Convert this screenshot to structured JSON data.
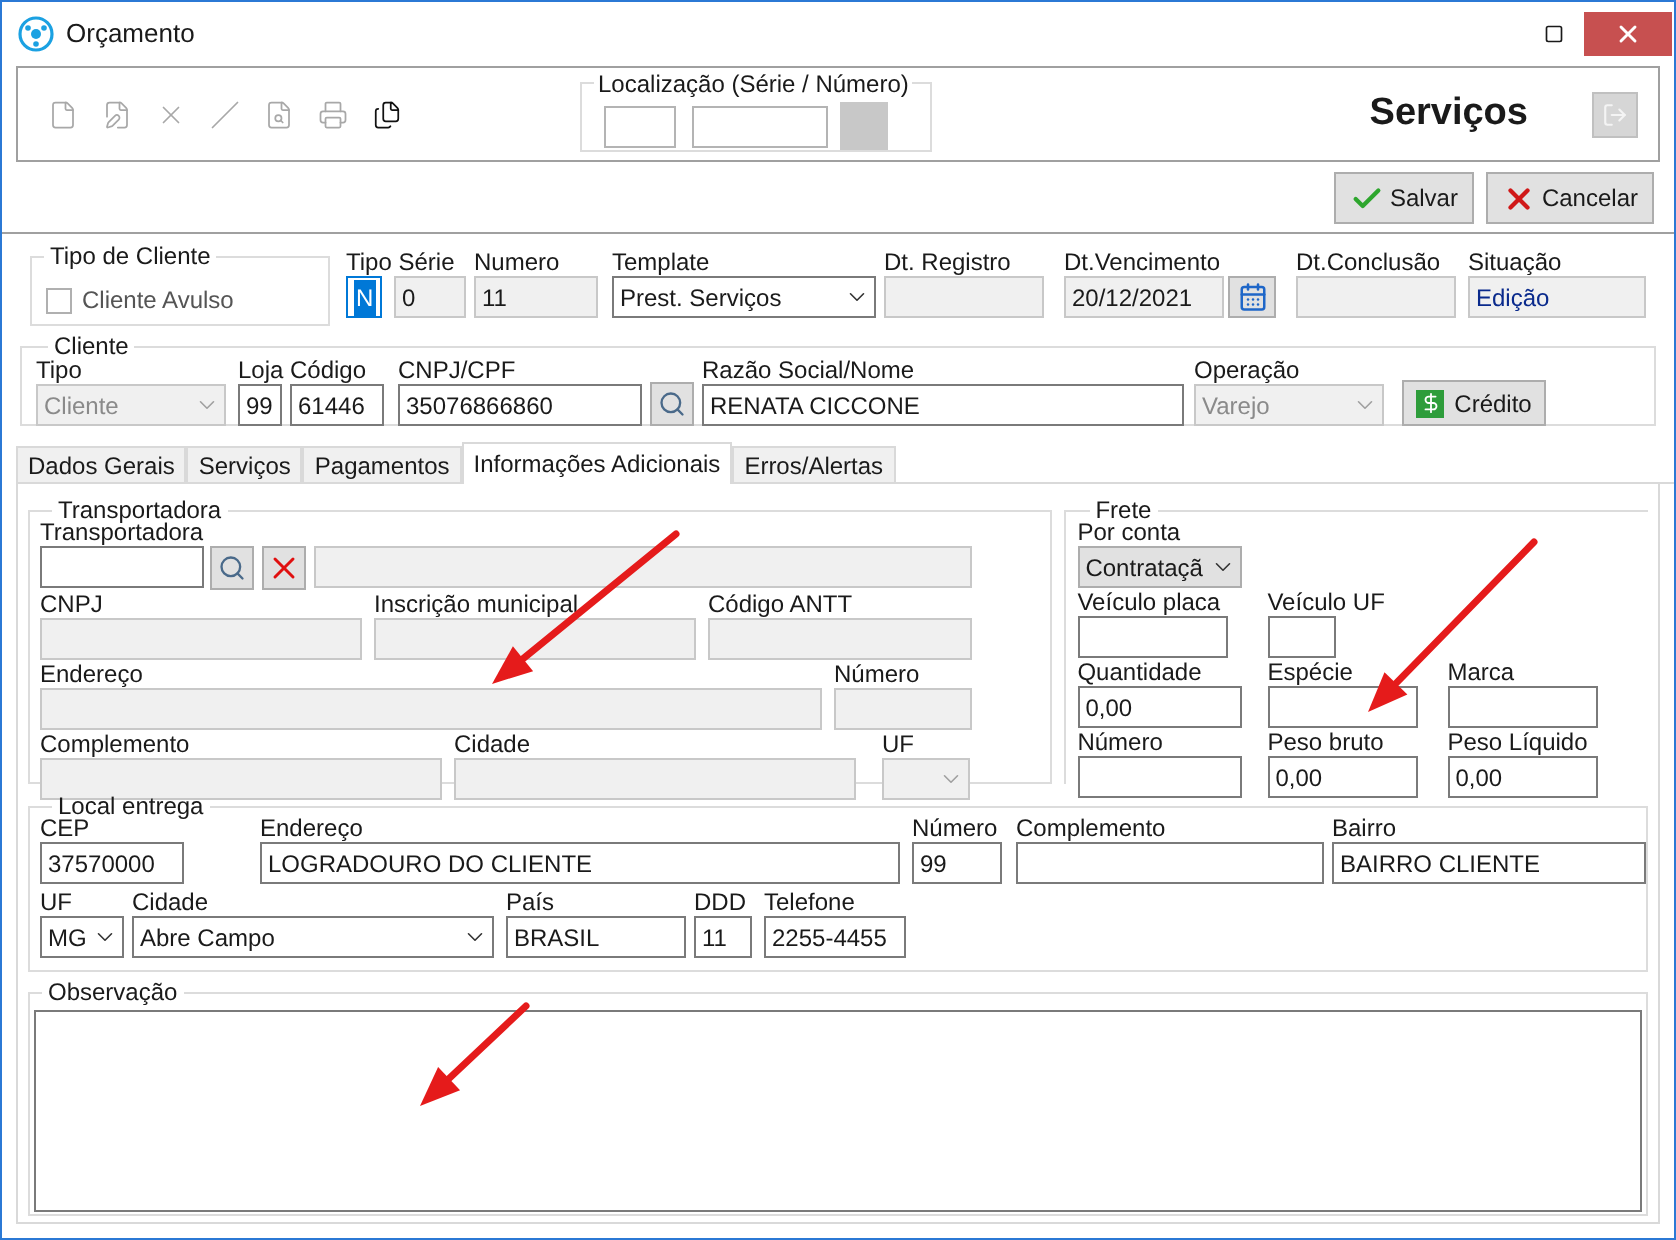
{
  "window": {
    "title": "Orçamento"
  },
  "toolbar": {
    "tools": [
      {
        "kind": "new",
        "disabled": true
      },
      {
        "kind": "edit",
        "disabled": true
      },
      {
        "kind": "delete",
        "disabled": true
      },
      {
        "kind": "pencil",
        "disabled": true
      },
      {
        "kind": "preview",
        "disabled": true
      },
      {
        "kind": "print",
        "disabled": true
      },
      {
        "kind": "copy",
        "disabled": false
      }
    ],
    "localizacao": {
      "label": "Localização (Série / Número)"
    },
    "module_title": "Serviços",
    "exit_button": {
      "disabled": true
    }
  },
  "actions": [
    {
      "kind": "save",
      "label": "Salvar"
    },
    {
      "kind": "cancel",
      "label": "Cancelar"
    }
  ],
  "tipo_cliente": {
    "title": "Tipo de Cliente",
    "checkbox": {
      "label": "Cliente Avulso",
      "checked": false
    }
  },
  "header_fields": [
    {
      "kind": "text",
      "label": "Tipo Série",
      "value": "N",
      "readonly": false,
      "focused": true
    },
    {
      "kind": "text",
      "value": "0",
      "readonly": true,
      "focused": false
    },
    {
      "kind": "text",
      "label": "Numero",
      "value": "11",
      "readonly": true,
      "focused": false
    },
    {
      "kind": "select",
      "label": "Template",
      "value": "Prest. Serviços",
      "disabled": false
    },
    {
      "kind": "text",
      "label": "Dt. Registro",
      "readonly": true,
      "focused": false
    },
    {
      "kind": "text",
      "label": "Dt.Vencimento",
      "value": "20/12/2021",
      "readonly": true,
      "focused": false
    },
    {
      "kind": "calendar_button"
    },
    {
      "kind": "text",
      "label": "Dt.Conclusão",
      "readonly": true,
      "focused": false
    },
    {
      "kind": "status",
      "label": "Situação",
      "value": "Edição"
    }
  ],
  "cliente": {
    "title": "Cliente",
    "fields": [
      {
        "kind": "select",
        "label": "Tipo",
        "value": "Cliente",
        "disabled": true
      },
      {
        "kind": "text",
        "label": "Loja",
        "value": "99",
        "readonly": false,
        "focused": false
      },
      {
        "kind": "text",
        "label": "Código",
        "value": "61446",
        "readonly": false,
        "focused": false
      },
      {
        "kind": "text",
        "label": "CNPJ/CPF",
        "value": "35076866860",
        "readonly": false,
        "focused": false
      },
      {
        "kind": "search_button"
      },
      {
        "kind": "text",
        "label": "Razão Social/Nome",
        "value": "RENATA CICCONE",
        "readonly": false,
        "focused": false
      },
      {
        "kind": "select",
        "label": "Operação",
        "value": "Varejo",
        "disabled": true
      },
      {
        "kind": "credit_button",
        "label": "Crédito"
      }
    ]
  },
  "tabs": [
    {
      "label": "Dados Gerais",
      "selected": false
    },
    {
      "label": "Serviços",
      "selected": false
    },
    {
      "label": "Pagamentos",
      "selected": false
    },
    {
      "label": "Informações Adicionais",
      "selected": true
    },
    {
      "label": "Erros/Alertas",
      "selected": false
    }
  ],
  "transportadora": {
    "title": "Transportadora",
    "rows": [
      {
        "fields": [
          {
            "kind": "text",
            "label": "Transportadora",
            "readonly": false,
            "focused": false
          },
          {
            "kind": "search_button"
          },
          {
            "kind": "clear_button"
          },
          {
            "kind": "text",
            "readonly": true,
            "focused": false
          }
        ]
      },
      {
        "fields": [
          {
            "kind": "text",
            "label": "CNPJ",
            "readonly": true,
            "focused": false
          },
          {
            "kind": "text",
            "label": "Inscrição municipal",
            "readonly": true,
            "focused": false
          },
          {
            "kind": "text",
            "label": "Código ANTT",
            "readonly": true,
            "focused": false
          }
        ]
      },
      {
        "fields": [
          {
            "kind": "text",
            "label": "Endereço",
            "readonly": true,
            "focused": false
          },
          {
            "kind": "text",
            "label": "Número",
            "readonly": true,
            "focused": false
          }
        ]
      },
      {
        "fields": [
          {
            "kind": "text",
            "label": "Complemento",
            "readonly": true,
            "focused": false
          },
          {
            "kind": "text",
            "label": "Cidade",
            "readonly": true,
            "focused": false
          },
          {
            "kind": "select",
            "label": "UF",
            "disabled": true
          }
        ]
      }
    ]
  },
  "frete": {
    "title": "Frete",
    "rows": [
      {
        "fields": [
          {
            "kind": "select",
            "label": "Por conta",
            "value": "Contrataçã",
            "disabled": false,
            "shaded": true
          }
        ]
      },
      {
        "fields": [
          {
            "kind": "text",
            "label": "Veículo placa",
            "readonly": false,
            "focused": false
          },
          {
            "kind": "text",
            "label": "Veículo UF",
            "readonly": false,
            "focused": false
          }
        ]
      },
      {
        "fields": [
          {
            "kind": "text",
            "label": "Quantidade",
            "value": "0,00",
            "readonly": false,
            "focused": false
          },
          {
            "kind": "text",
            "label": "Espécie",
            "readonly": false,
            "focused": false
          },
          {
            "kind": "text",
            "label": "Marca",
            "readonly": false,
            "focused": false
          }
        ]
      },
      {
        "fields": [
          {
            "kind": "text",
            "label": "Número",
            "readonly": false,
            "focused": false
          },
          {
            "kind": "text",
            "label": "Peso bruto",
            "value": "0,00",
            "readonly": false,
            "focused": false
          },
          {
            "kind": "text",
            "label": "Peso Líquido",
            "value": "0,00",
            "readonly": false,
            "focused": false
          }
        ]
      }
    ]
  },
  "local_entrega": {
    "title": "Local entrega",
    "rows": [
      {
        "fields": [
          {
            "kind": "text",
            "label": "CEP",
            "value": "37570000",
            "readonly": false,
            "focused": false
          },
          {
            "kind": "text",
            "label": "Endereço",
            "value": "LOGRADOURO DO CLIENTE",
            "readonly": false,
            "focused": false
          },
          {
            "kind": "text",
            "label": "Número",
            "value": "99",
            "readonly": false,
            "focused": false
          },
          {
            "kind": "text",
            "label": "Complemento",
            "readonly": false,
            "focused": false
          },
          {
            "kind": "text",
            "label": "Bairro",
            "value": "BAIRRO CLIENTE",
            "readonly": false,
            "focused": false
          }
        ]
      },
      {
        "fields": [
          {
            "kind": "select",
            "label": "UF",
            "value": "MG",
            "disabled": false
          },
          {
            "kind": "select",
            "label": "Cidade",
            "value": "Abre Campo",
            "disabled": false
          },
          {
            "kind": "text",
            "label": "País",
            "value": "BRASIL",
            "readonly": false,
            "focused": false
          },
          {
            "kind": "text",
            "label": "DDD",
            "value": "11",
            "readonly": false,
            "focused": false
          },
          {
            "kind": "text",
            "label": "Telefone",
            "value": "2255-4455",
            "readonly": false,
            "focused": false
          }
        ]
      }
    ]
  },
  "observacao": {
    "title": "Observação"
  }
}
